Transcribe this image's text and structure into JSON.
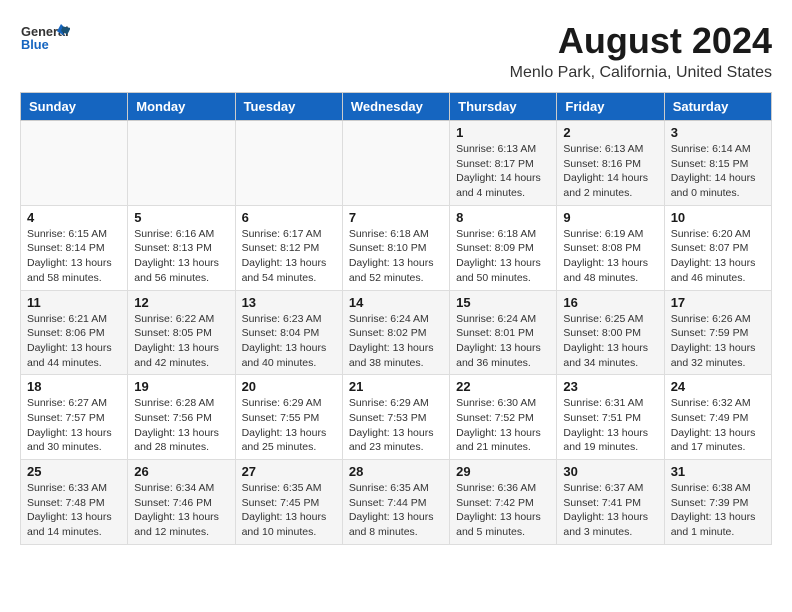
{
  "header": {
    "logo_general": "General",
    "logo_blue": "Blue",
    "title": "August 2024",
    "location": "Menlo Park, California, United States"
  },
  "weekdays": [
    "Sunday",
    "Monday",
    "Tuesday",
    "Wednesday",
    "Thursday",
    "Friday",
    "Saturday"
  ],
  "weeks": [
    [
      {
        "day": "",
        "info": ""
      },
      {
        "day": "",
        "info": ""
      },
      {
        "day": "",
        "info": ""
      },
      {
        "day": "",
        "info": ""
      },
      {
        "day": "1",
        "info": "Sunrise: 6:13 AM\nSunset: 8:17 PM\nDaylight: 14 hours\nand 4 minutes."
      },
      {
        "day": "2",
        "info": "Sunrise: 6:13 AM\nSunset: 8:16 PM\nDaylight: 14 hours\nand 2 minutes."
      },
      {
        "day": "3",
        "info": "Sunrise: 6:14 AM\nSunset: 8:15 PM\nDaylight: 14 hours\nand 0 minutes."
      }
    ],
    [
      {
        "day": "4",
        "info": "Sunrise: 6:15 AM\nSunset: 8:14 PM\nDaylight: 13 hours\nand 58 minutes."
      },
      {
        "day": "5",
        "info": "Sunrise: 6:16 AM\nSunset: 8:13 PM\nDaylight: 13 hours\nand 56 minutes."
      },
      {
        "day": "6",
        "info": "Sunrise: 6:17 AM\nSunset: 8:12 PM\nDaylight: 13 hours\nand 54 minutes."
      },
      {
        "day": "7",
        "info": "Sunrise: 6:18 AM\nSunset: 8:10 PM\nDaylight: 13 hours\nand 52 minutes."
      },
      {
        "day": "8",
        "info": "Sunrise: 6:18 AM\nSunset: 8:09 PM\nDaylight: 13 hours\nand 50 minutes."
      },
      {
        "day": "9",
        "info": "Sunrise: 6:19 AM\nSunset: 8:08 PM\nDaylight: 13 hours\nand 48 minutes."
      },
      {
        "day": "10",
        "info": "Sunrise: 6:20 AM\nSunset: 8:07 PM\nDaylight: 13 hours\nand 46 minutes."
      }
    ],
    [
      {
        "day": "11",
        "info": "Sunrise: 6:21 AM\nSunset: 8:06 PM\nDaylight: 13 hours\nand 44 minutes."
      },
      {
        "day": "12",
        "info": "Sunrise: 6:22 AM\nSunset: 8:05 PM\nDaylight: 13 hours\nand 42 minutes."
      },
      {
        "day": "13",
        "info": "Sunrise: 6:23 AM\nSunset: 8:04 PM\nDaylight: 13 hours\nand 40 minutes."
      },
      {
        "day": "14",
        "info": "Sunrise: 6:24 AM\nSunset: 8:02 PM\nDaylight: 13 hours\nand 38 minutes."
      },
      {
        "day": "15",
        "info": "Sunrise: 6:24 AM\nSunset: 8:01 PM\nDaylight: 13 hours\nand 36 minutes."
      },
      {
        "day": "16",
        "info": "Sunrise: 6:25 AM\nSunset: 8:00 PM\nDaylight: 13 hours\nand 34 minutes."
      },
      {
        "day": "17",
        "info": "Sunrise: 6:26 AM\nSunset: 7:59 PM\nDaylight: 13 hours\nand 32 minutes."
      }
    ],
    [
      {
        "day": "18",
        "info": "Sunrise: 6:27 AM\nSunset: 7:57 PM\nDaylight: 13 hours\nand 30 minutes."
      },
      {
        "day": "19",
        "info": "Sunrise: 6:28 AM\nSunset: 7:56 PM\nDaylight: 13 hours\nand 28 minutes."
      },
      {
        "day": "20",
        "info": "Sunrise: 6:29 AM\nSunset: 7:55 PM\nDaylight: 13 hours\nand 25 minutes."
      },
      {
        "day": "21",
        "info": "Sunrise: 6:29 AM\nSunset: 7:53 PM\nDaylight: 13 hours\nand 23 minutes."
      },
      {
        "day": "22",
        "info": "Sunrise: 6:30 AM\nSunset: 7:52 PM\nDaylight: 13 hours\nand 21 minutes."
      },
      {
        "day": "23",
        "info": "Sunrise: 6:31 AM\nSunset: 7:51 PM\nDaylight: 13 hours\nand 19 minutes."
      },
      {
        "day": "24",
        "info": "Sunrise: 6:32 AM\nSunset: 7:49 PM\nDaylight: 13 hours\nand 17 minutes."
      }
    ],
    [
      {
        "day": "25",
        "info": "Sunrise: 6:33 AM\nSunset: 7:48 PM\nDaylight: 13 hours\nand 14 minutes."
      },
      {
        "day": "26",
        "info": "Sunrise: 6:34 AM\nSunset: 7:46 PM\nDaylight: 13 hours\nand 12 minutes."
      },
      {
        "day": "27",
        "info": "Sunrise: 6:35 AM\nSunset: 7:45 PM\nDaylight: 13 hours\nand 10 minutes."
      },
      {
        "day": "28",
        "info": "Sunrise: 6:35 AM\nSunset: 7:44 PM\nDaylight: 13 hours\nand 8 minutes."
      },
      {
        "day": "29",
        "info": "Sunrise: 6:36 AM\nSunset: 7:42 PM\nDaylight: 13 hours\nand 5 minutes."
      },
      {
        "day": "30",
        "info": "Sunrise: 6:37 AM\nSunset: 7:41 PM\nDaylight: 13 hours\nand 3 minutes."
      },
      {
        "day": "31",
        "info": "Sunrise: 6:38 AM\nSunset: 7:39 PM\nDaylight: 13 hours\nand 1 minute."
      }
    ]
  ]
}
